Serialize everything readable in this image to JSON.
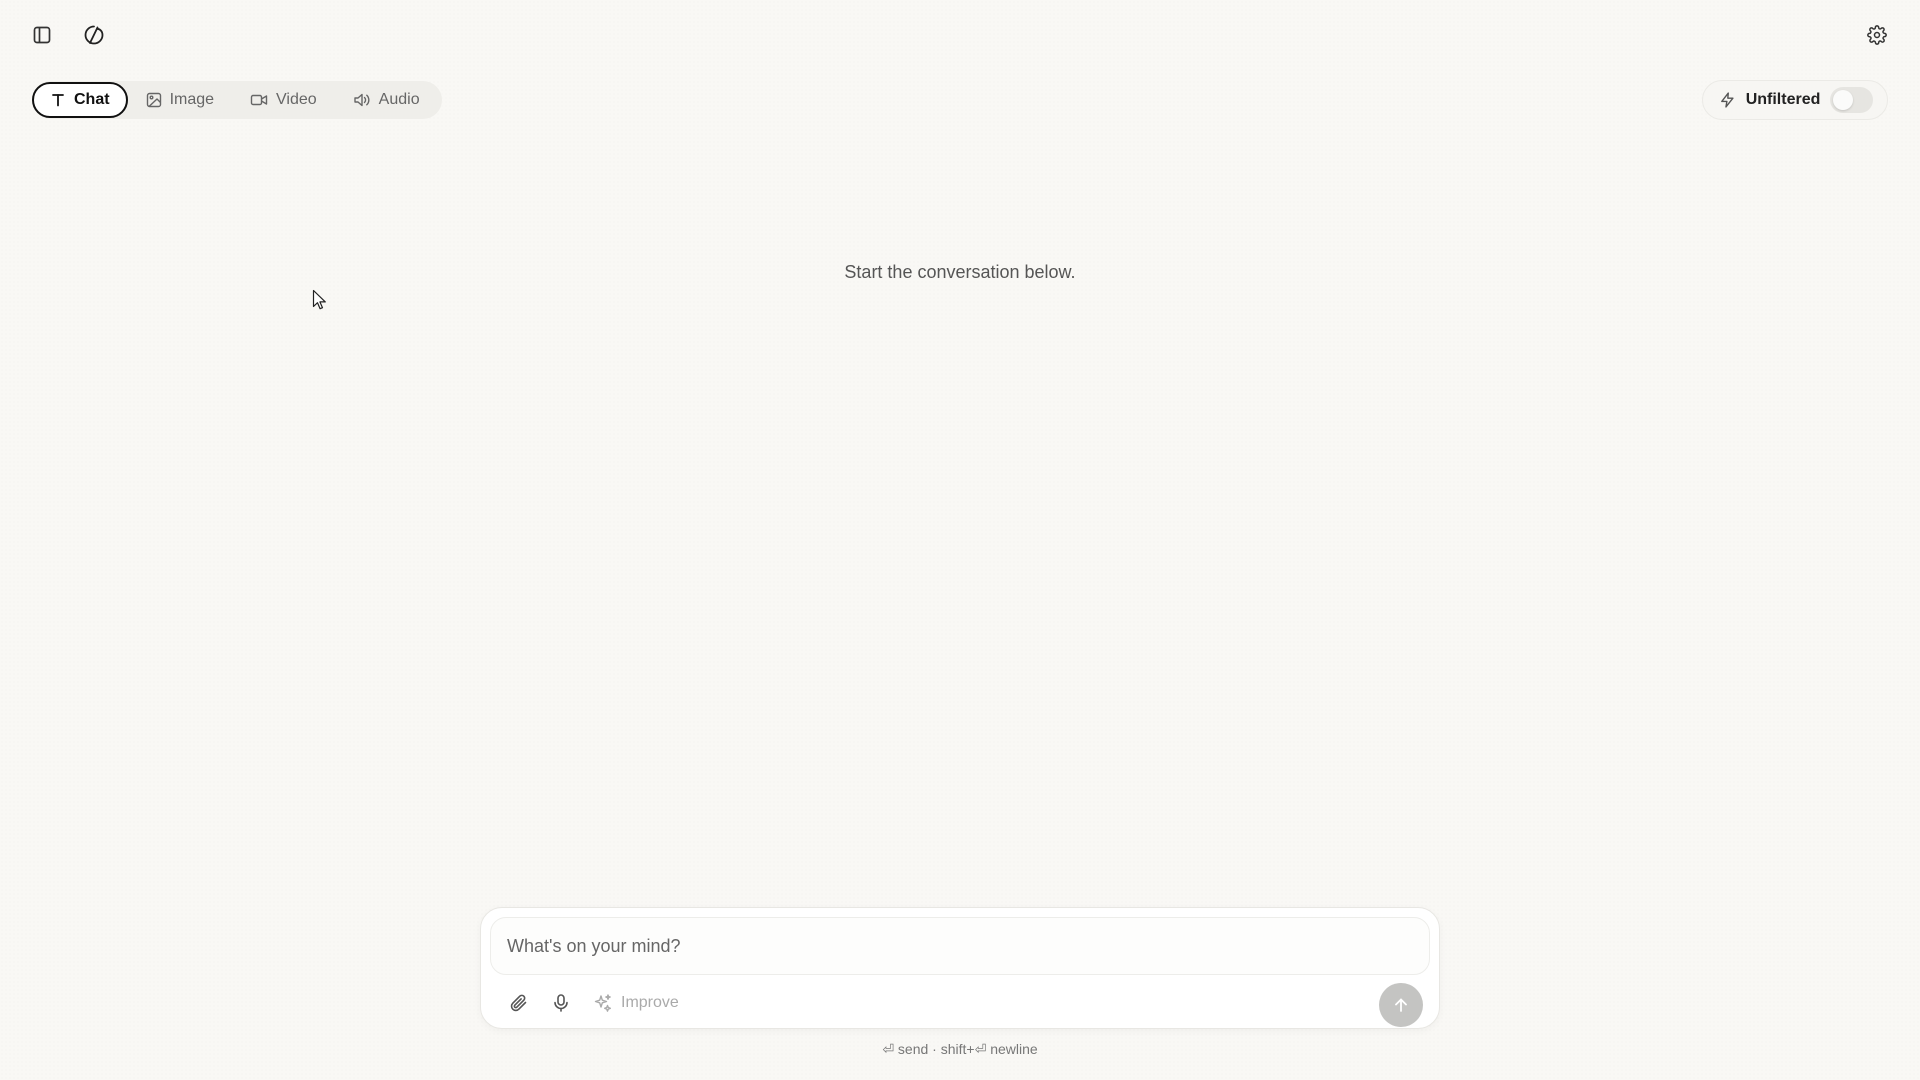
{
  "header": {
    "sidebar_toggle_icon": "sidebar-panel-icon",
    "logo_icon": "brand-swirl-icon",
    "settings_icon": "gear-icon"
  },
  "mode_tabs": [
    {
      "label": "Chat",
      "icon": "text-t-icon",
      "active": true
    },
    {
      "label": "Image",
      "icon": "image-icon",
      "active": false
    },
    {
      "label": "Video",
      "icon": "video-camera-icon",
      "active": false
    },
    {
      "label": "Audio",
      "icon": "speaker-icon",
      "active": false
    }
  ],
  "unfiltered": {
    "label": "Unfiltered",
    "icon": "lightning-icon",
    "enabled": false
  },
  "main": {
    "empty_prompt": "Start the conversation below."
  },
  "composer": {
    "placeholder": "What's on your mind?",
    "value": "",
    "attach_icon": "paperclip-icon",
    "mic_icon": "microphone-icon",
    "improve_label": "Improve",
    "improve_icon": "sparkles-icon",
    "send_icon": "arrow-up-icon",
    "hint": "⏎ send · shift+⏎ newline"
  },
  "colors": {
    "background": "#f9f8f5",
    "active_tab_border": "#111111",
    "send_button_disabled": "#c4c4c2"
  }
}
